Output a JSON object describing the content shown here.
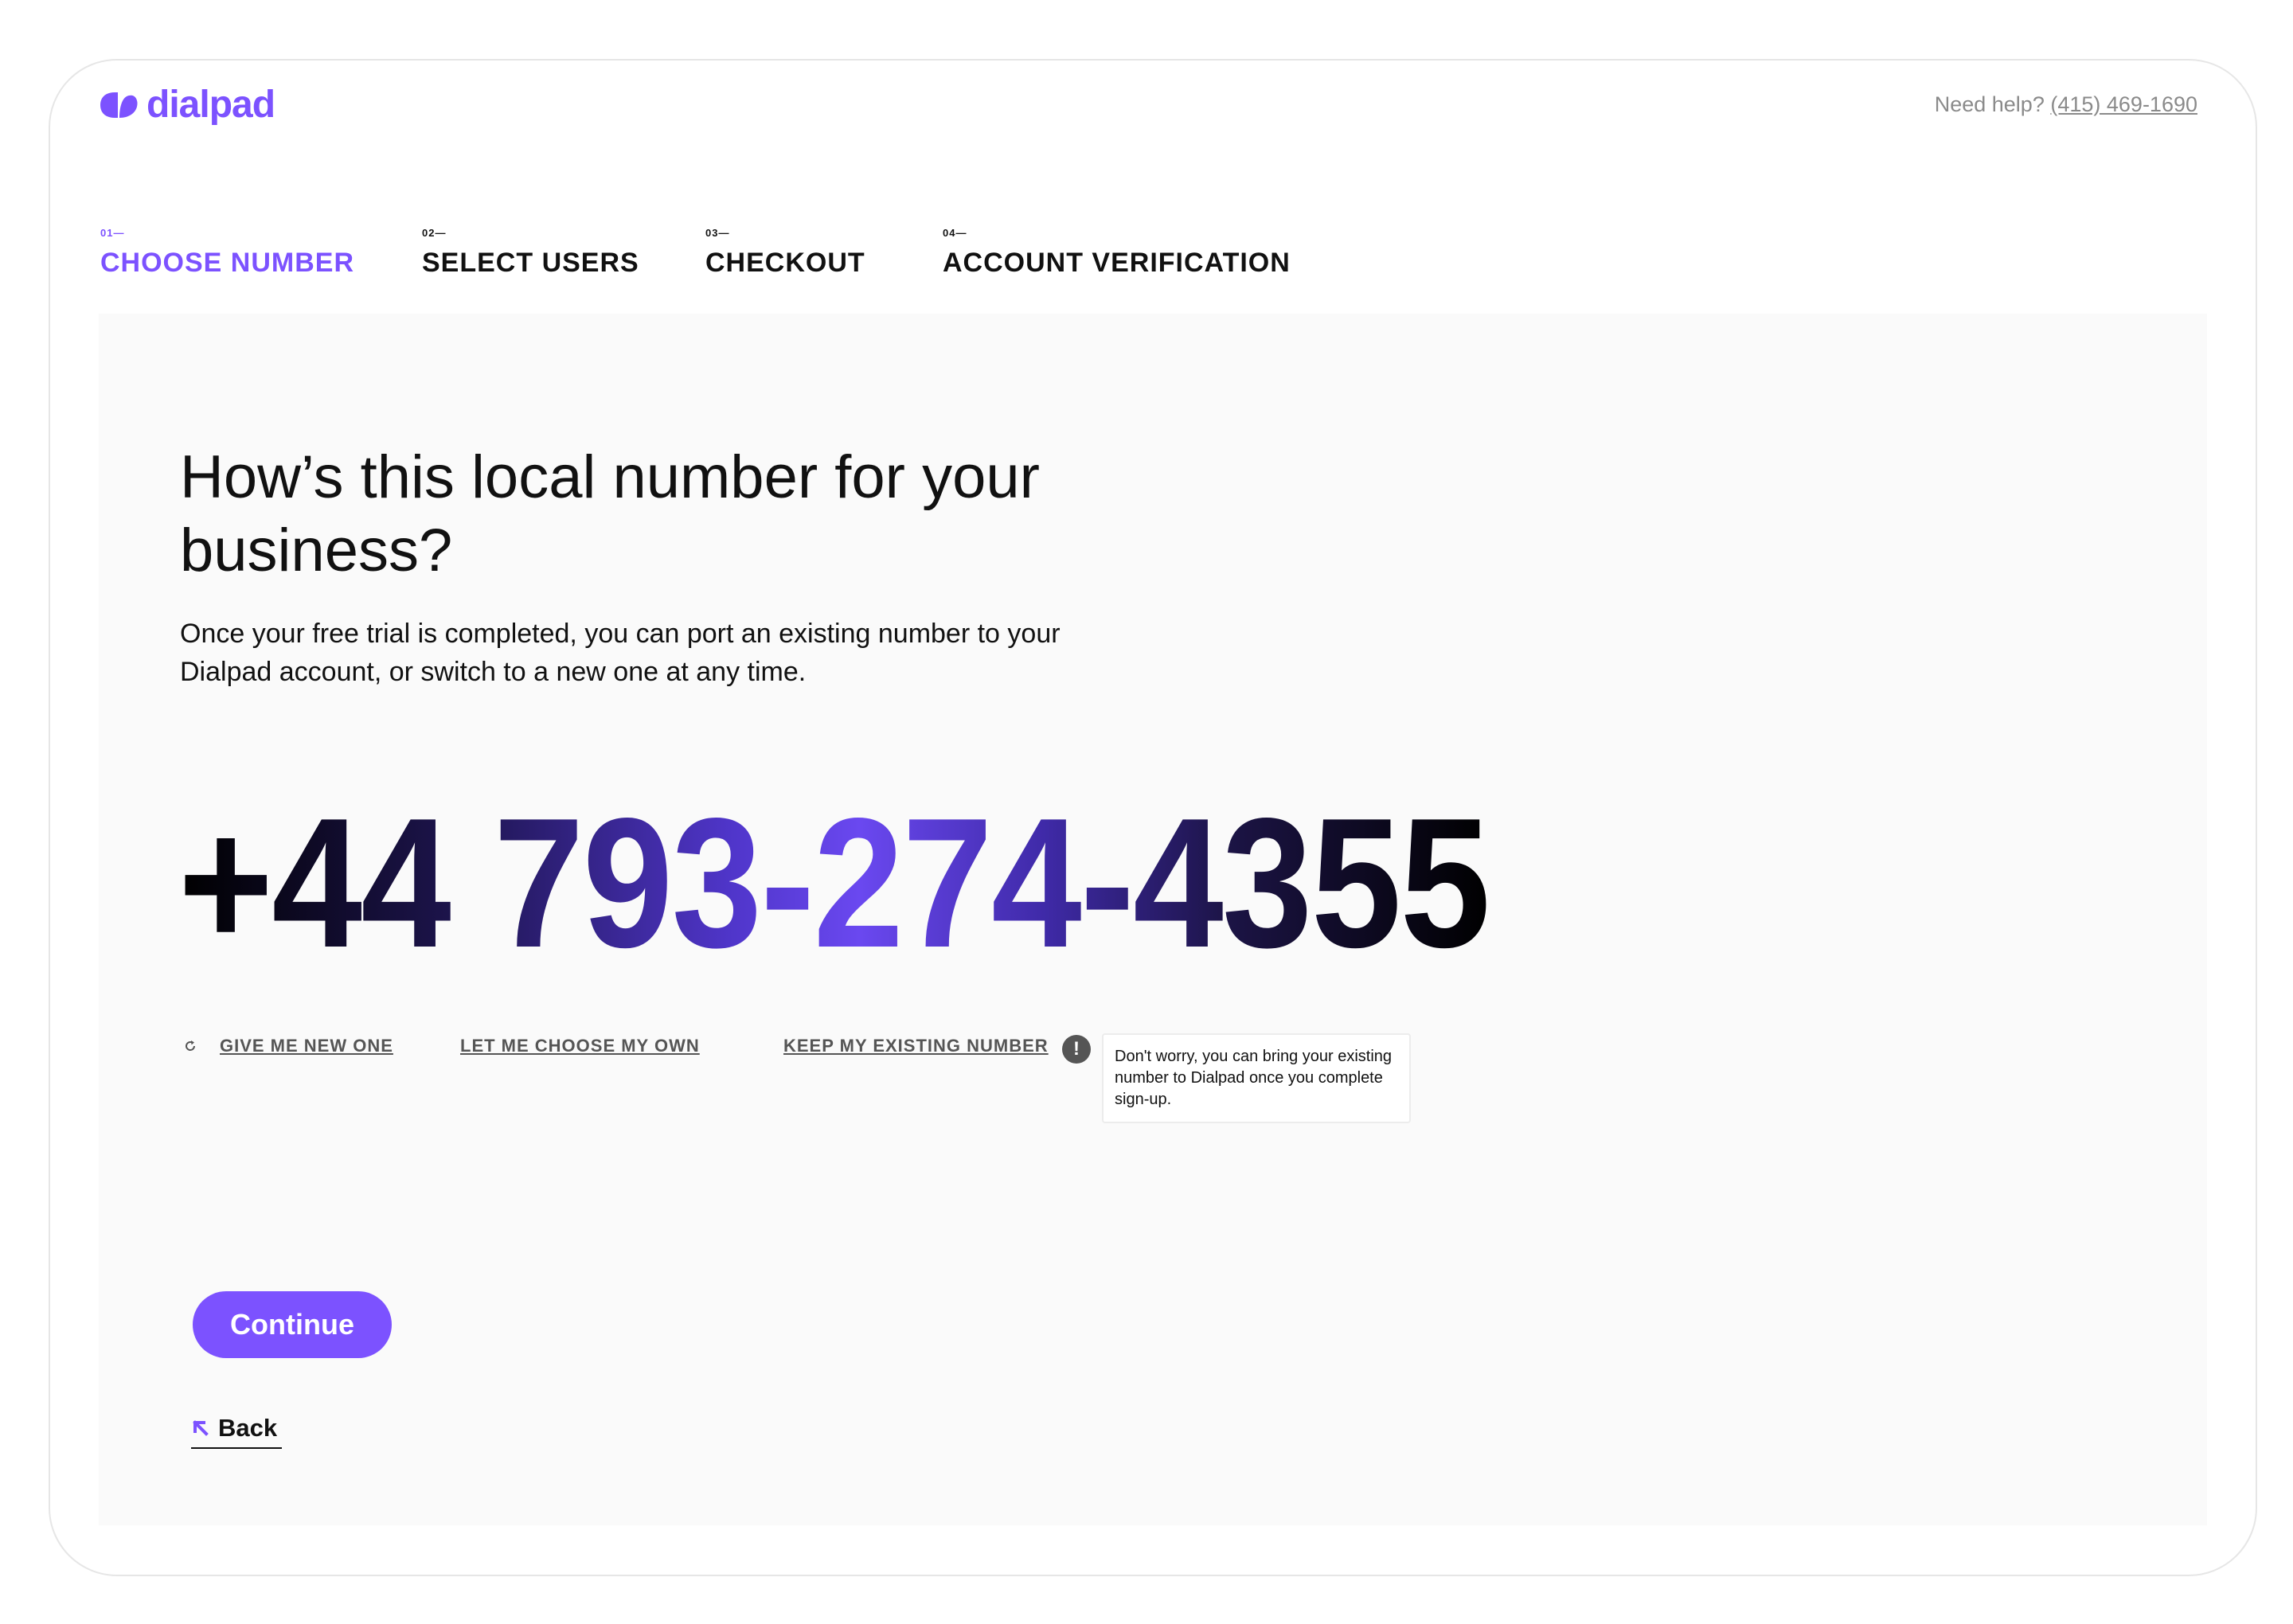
{
  "brand": {
    "name": "dialpad",
    "accent_color": "#7c52ff"
  },
  "header": {
    "help_prefix": "Need help?",
    "help_phone": "(415) 469-1690"
  },
  "steps": [
    {
      "number": "01—",
      "label": "CHOOSE NUMBER",
      "active": true
    },
    {
      "number": "02—",
      "label": "SELECT USERS",
      "active": false
    },
    {
      "number": "03—",
      "label": "CHECKOUT",
      "active": false
    },
    {
      "number": "04—",
      "label": "ACCOUNT VERIFICATION",
      "active": false
    }
  ],
  "main": {
    "headline": "How’s this local number for your business?",
    "subtext": "Once your free trial is completed, you can port an existing number to your Dialpad account, or switch to a new one at any time.",
    "phone_number": "+44 793-274-4355",
    "actions": {
      "new_one": "GIVE ME NEW ONE",
      "choose_own": "LET ME CHOOSE MY OWN",
      "keep_existing": "KEEP MY EXISTING NUMBER"
    },
    "info_icon_glyph": "!",
    "tooltip": "Don't worry, you can bring your existing number to Dialpad once you complete sign-up.",
    "continue_label": "Continue",
    "back_label": "Back"
  }
}
